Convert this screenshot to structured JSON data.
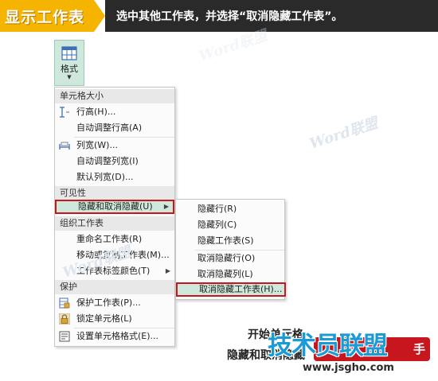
{
  "banner": {
    "tag": "显示工作表",
    "instruction": "选中其他工作表，并选择“取消隐藏工作表”。",
    "tag_color": "#f5b400",
    "bar_color": "#2a2a2a"
  },
  "ribbon": {
    "format_button": {
      "label": "格式",
      "icon": "format-cells-icon"
    }
  },
  "menu": {
    "sections": [
      {
        "header": "单元格大小",
        "items": [
          {
            "label": "行高(H)...",
            "icon": "row-height-icon"
          },
          {
            "label": "自动调整行高(A)"
          },
          {
            "label": "列宽(W)...",
            "icon": "column-width-icon"
          },
          {
            "label": "自动调整列宽(I)"
          },
          {
            "label": "默认列宽(D)..."
          }
        ]
      },
      {
        "header": "可见性",
        "items": [
          {
            "label": "隐藏和取消隐藏(U)",
            "highlighted": true,
            "has_submenu": true
          }
        ]
      },
      {
        "header": "组织工作表",
        "items": [
          {
            "label": "重命名工作表(R)"
          },
          {
            "label": "移动或复制工作表(M)..."
          },
          {
            "label": "工作表标签颜色(T)",
            "has_submenu": true
          }
        ]
      },
      {
        "header": "保护",
        "items": [
          {
            "label": "保护工作表(P)...",
            "icon": "protect-sheet-icon"
          },
          {
            "label": "锁定单元格(L)",
            "icon": "lock-icon"
          },
          {
            "label": "设置单元格格式(E)...",
            "icon": "format-cells-dialog-icon"
          }
        ]
      }
    ]
  },
  "submenu": {
    "items": [
      {
        "label": "隐藏行(R)"
      },
      {
        "label": "隐藏列(C)"
      },
      {
        "label": "隐藏工作表(S)"
      },
      {
        "label": "取消隐藏行(O)"
      },
      {
        "label": "取消隐藏列(L)"
      },
      {
        "label": "取消隐藏工作表(H)...",
        "highlighted": true
      }
    ]
  },
  "watermarks": [
    "Word联盟",
    "Word联盟",
    "Word联盟"
  ],
  "background_text": {
    "line1": "开始单元格",
    "line2": "隐藏和取消隐藏"
  },
  "site_logo": {
    "main": "技术员联盟",
    "tagline": "手",
    "url": "www.jsgho.com"
  },
  "colors": {
    "highlight_border": "#c7161d",
    "highlight_fill": "#cfe8dc",
    "logo_blue": "#1c9ad6"
  }
}
